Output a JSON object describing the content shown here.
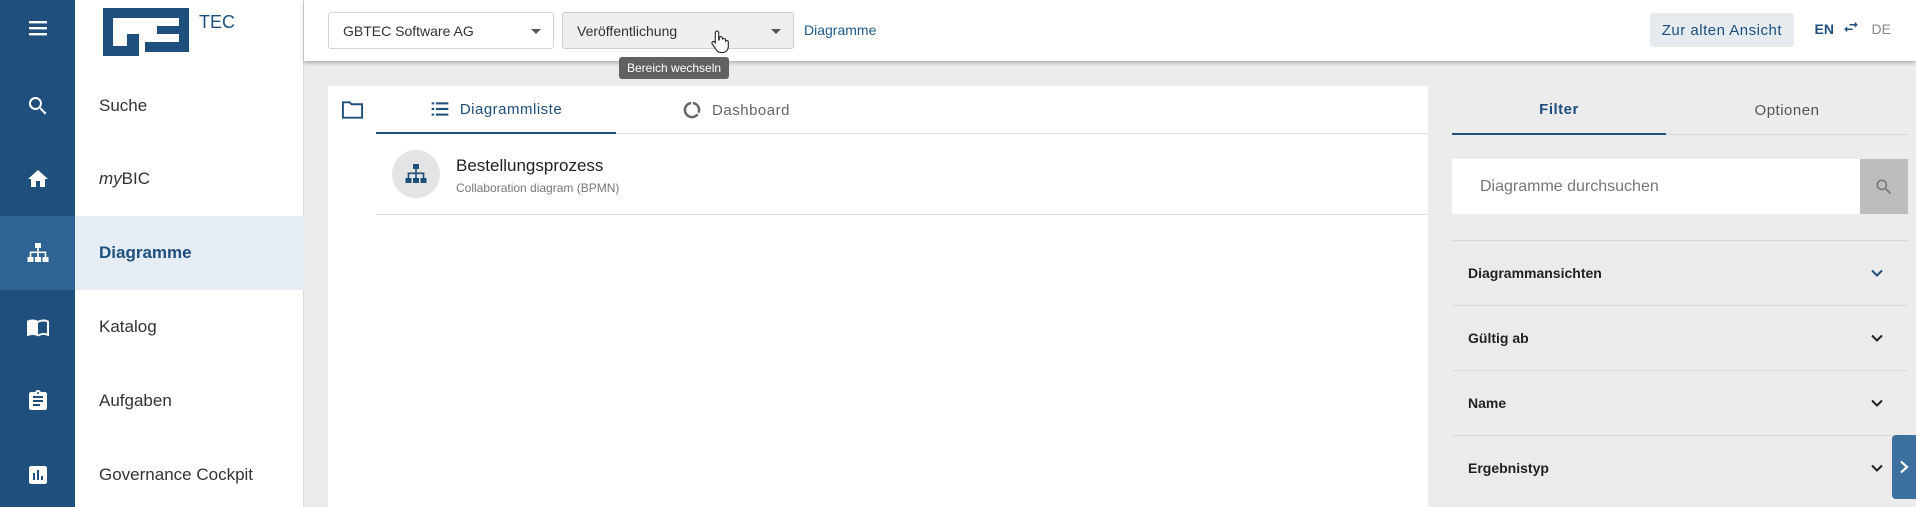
{
  "brand": {
    "logo_text": "GB TEC"
  },
  "nav": {
    "items": [
      {
        "label": "Suche",
        "icon": "search-icon"
      },
      {
        "prefix": "my",
        "label": " BIC",
        "icon": "home-icon"
      },
      {
        "label": "Diagramme",
        "icon": "sitemap-icon",
        "active": true
      },
      {
        "label": "Katalog",
        "icon": "book-icon"
      },
      {
        "label": "Aufgaben",
        "icon": "clipboard-icon"
      },
      {
        "label": "Governance Cockpit",
        "icon": "chart-icon"
      }
    ]
  },
  "header": {
    "org_select": "GBTEC Software AG",
    "stage_select": "Veröffentlichung",
    "breadcrumb": "Diagramme",
    "tooltip": "Bereich wechseln",
    "old_view_button": "Zur alten Ansicht",
    "lang_active": "EN",
    "lang_other": "DE"
  },
  "main": {
    "tabs": [
      {
        "label": "Diagrammliste",
        "icon": "list-icon",
        "active": true
      },
      {
        "label": "Dashboard",
        "icon": "dashboard-icon",
        "active": false
      }
    ],
    "rows": [
      {
        "title": "Bestellungsprozess",
        "subtitle": "Collaboration diagram (BPMN)"
      }
    ]
  },
  "panel": {
    "tabs": [
      {
        "label": "Filter",
        "active": true
      },
      {
        "label": "Optionen",
        "active": false
      }
    ],
    "search_placeholder": "Diagramme durchsuchen",
    "filters": [
      "Diagrammansichten",
      "Gültig ab",
      "Name",
      "Ergebnistyp"
    ]
  },
  "colors": {
    "brand": "#1e4f7d",
    "rail_active": "#2f6394"
  }
}
